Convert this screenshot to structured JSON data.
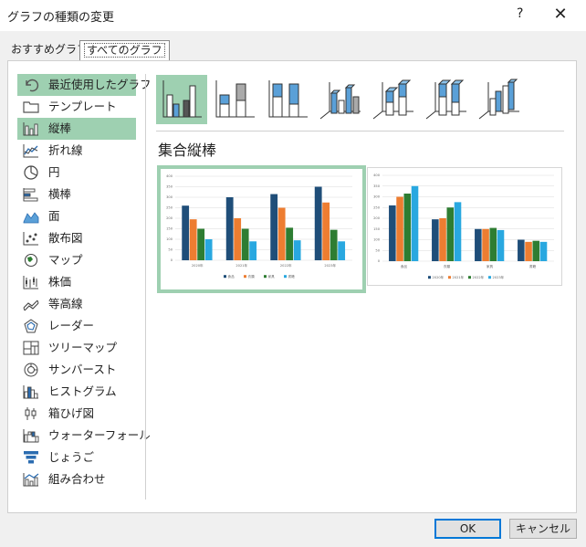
{
  "dialog": {
    "title": "グラフの種類の変更",
    "help": "?",
    "close": "✕"
  },
  "tabs": [
    {
      "label": "おすすめグラフ"
    },
    {
      "label": "すべてのグラフ"
    }
  ],
  "sidebar": {
    "items": [
      {
        "label": "最近使用したグラフ",
        "icon": "undo-icon"
      },
      {
        "label": "テンプレート",
        "icon": "folder-icon"
      },
      {
        "label": "縦棒",
        "icon": "column-chart-icon"
      },
      {
        "label": "折れ線",
        "icon": "line-chart-icon"
      },
      {
        "label": "円",
        "icon": "pie-chart-icon"
      },
      {
        "label": "横棒",
        "icon": "bar-chart-icon"
      },
      {
        "label": "面",
        "icon": "area-chart-icon"
      },
      {
        "label": "散布図",
        "icon": "scatter-chart-icon"
      },
      {
        "label": "マップ",
        "icon": "map-chart-icon"
      },
      {
        "label": "株価",
        "icon": "stock-chart-icon"
      },
      {
        "label": "等高線",
        "icon": "surface-chart-icon"
      },
      {
        "label": "レーダー",
        "icon": "radar-chart-icon"
      },
      {
        "label": "ツリーマップ",
        "icon": "treemap-icon"
      },
      {
        "label": "サンバースト",
        "icon": "sunburst-icon"
      },
      {
        "label": "ヒストグラム",
        "icon": "histogram-icon"
      },
      {
        "label": "箱ひげ図",
        "icon": "box-whisker-icon"
      },
      {
        "label": "ウォーターフォール",
        "icon": "waterfall-icon"
      },
      {
        "label": "じょうご",
        "icon": "funnel-icon"
      },
      {
        "label": "組み合わせ",
        "icon": "combo-chart-icon"
      }
    ]
  },
  "section_title": "集合縦棒",
  "colors": {
    "accent": "#9ed0b1",
    "series": [
      "#1f4e79",
      "#ed7d31",
      "#2e7d32",
      "#29a8e0"
    ]
  },
  "chart_data": [
    {
      "type": "bar",
      "categories": [
        "2020年",
        "2021年",
        "2022年",
        "2023年"
      ],
      "series": [
        {
          "name": "食品",
          "values": [
            260,
            300,
            315,
            350
          ]
        },
        {
          "name": "衣類",
          "values": [
            195,
            200,
            250,
            275
          ]
        },
        {
          "name": "家具",
          "values": [
            150,
            150,
            155,
            145
          ]
        },
        {
          "name": "書籍",
          "values": [
            100,
            90,
            95,
            90
          ]
        }
      ],
      "ylim": [
        0,
        400
      ],
      "yticks": [
        "0",
        "50",
        "100",
        "150",
        "200",
        "250",
        "300",
        "350",
        "400"
      ],
      "legend": "bottom"
    },
    {
      "type": "bar",
      "categories": [
        "食品",
        "衣類",
        "家具",
        "書籍"
      ],
      "series": [
        {
          "name": "2020年",
          "values": [
            260,
            195,
            150,
            100
          ]
        },
        {
          "name": "2021年",
          "values": [
            300,
            200,
            150,
            90
          ]
        },
        {
          "name": "2022年",
          "values": [
            315,
            250,
            155,
            95
          ]
        },
        {
          "name": "2023年",
          "values": [
            350,
            275,
            145,
            90
          ]
        }
      ],
      "ylim": [
        0,
        400
      ],
      "yticks": [
        "0",
        "50",
        "100",
        "150",
        "200",
        "250",
        "300",
        "350",
        "400"
      ],
      "legend": "bottom"
    }
  ],
  "buttons": {
    "ok": "OK",
    "cancel": "キャンセル"
  }
}
